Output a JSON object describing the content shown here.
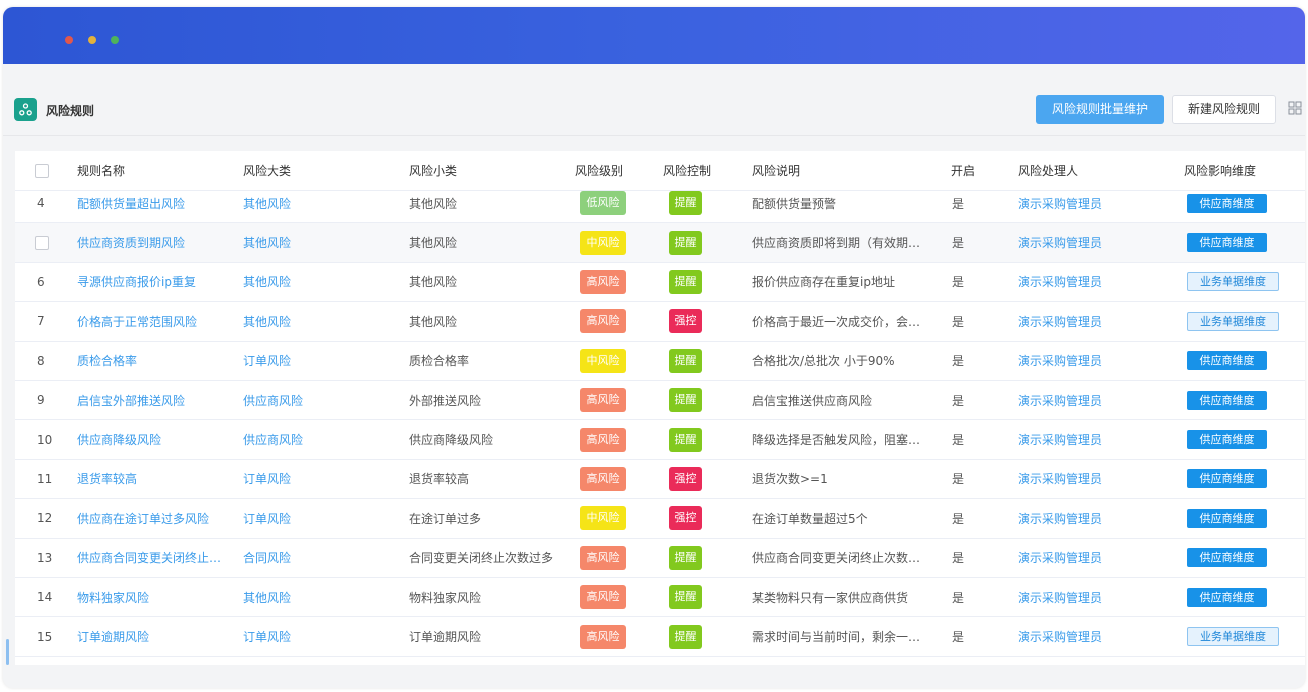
{
  "app": {
    "title": "风险规则"
  },
  "toolbar": {
    "batch_label": "风险规则批量维护",
    "new_label": "新建风险规则"
  },
  "colors": {
    "low": "#8dd07c",
    "mid": "#f5e417",
    "high": "#f5876a",
    "remind": "#82c91e",
    "strong": "#ea2b59"
  },
  "table": {
    "headers": [
      "规则名称",
      "风险大类",
      "风险小类",
      "风险级别",
      "风险控制",
      "风险说明",
      "开启",
      "风险处理人",
      "风险影响维度"
    ],
    "rows": [
      {
        "no": "4",
        "name": "配额供货量超出风险",
        "cat": "其他风险",
        "sub": "其他风险",
        "level": "低风险",
        "lv": "low",
        "ctrl": "提醒",
        "ct": "remind",
        "desc": "配额供货量预警",
        "on": "是",
        "owner": "演示采购管理员",
        "dim": "供应商维度",
        "dt": "solid"
      },
      {
        "no": "",
        "name": "供应商资质到期风险",
        "cat": "其他风险",
        "sub": "其他风险",
        "level": "中风险",
        "lv": "mid",
        "ctrl": "提醒",
        "ct": "remind",
        "desc": "供应商资质即将到期（有效期…",
        "on": "是",
        "owner": "演示采购管理员",
        "dim": "供应商维度",
        "dt": "solid"
      },
      {
        "no": "6",
        "name": "寻源供应商报价ip重复",
        "cat": "其他风险",
        "sub": "其他风险",
        "level": "高风险",
        "lv": "high",
        "ctrl": "提醒",
        "ct": "remind",
        "desc": "报价供应商存在重复ip地址",
        "on": "是",
        "owner": "演示采购管理员",
        "dim": "业务单据维度",
        "dt": "outline"
      },
      {
        "no": "7",
        "name": "价格高于正常范围风险",
        "cat": "其他风险",
        "sub": "其他风险",
        "level": "高风险",
        "lv": "high",
        "ctrl": "强控",
        "ct": "strong",
        "desc": "价格高于最近一次成交价，会…",
        "on": "是",
        "owner": "演示采购管理员",
        "dim": "业务单据维度",
        "dt": "outline"
      },
      {
        "no": "8",
        "name": "质检合格率",
        "cat": "订单风险",
        "sub": "质检合格率",
        "level": "中风险",
        "lv": "mid",
        "ctrl": "提醒",
        "ct": "remind",
        "desc": "合格批次/总批次 小于90%",
        "on": "是",
        "owner": "演示采购管理员",
        "dim": "供应商维度",
        "dt": "solid"
      },
      {
        "no": "9",
        "name": "启信宝外部推送风险",
        "cat": "供应商风险",
        "sub": "外部推送风险",
        "level": "高风险",
        "lv": "high",
        "ctrl": "提醒",
        "ct": "remind",
        "desc": "启信宝推送供应商风险",
        "on": "是",
        "owner": "演示采购管理员",
        "dim": "供应商维度",
        "dt": "solid"
      },
      {
        "no": "10",
        "name": "供应商降级风险",
        "cat": "供应商风险",
        "sub": "供应商降级风险",
        "level": "高风险",
        "lv": "high",
        "ctrl": "提醒",
        "ct": "remind",
        "desc": "降级选择是否触发风险，阻塞…",
        "on": "是",
        "owner": "演示采购管理员",
        "dim": "供应商维度",
        "dt": "solid"
      },
      {
        "no": "11",
        "name": "退货率较高",
        "cat": "订单风险",
        "sub": "退货率较高",
        "level": "高风险",
        "lv": "high",
        "ctrl": "强控",
        "ct": "strong",
        "desc": "退货次数>=1",
        "on": "是",
        "owner": "演示采购管理员",
        "dim": "供应商维度",
        "dt": "solid"
      },
      {
        "no": "12",
        "name": "供应商在途订单过多风险",
        "cat": "订单风险",
        "sub": "在途订单过多",
        "level": "中风险",
        "lv": "mid",
        "ctrl": "强控",
        "ct": "strong",
        "desc": "在途订单数量超过5个",
        "on": "是",
        "owner": "演示采购管理员",
        "dim": "供应商维度",
        "dt": "solid"
      },
      {
        "no": "13",
        "name": "供应商合同变更关闭终止…",
        "cat": "合同风险",
        "sub": "合同变更关闭终止次数过多",
        "level": "高风险",
        "lv": "high",
        "ctrl": "提醒",
        "ct": "remind",
        "desc": "供应商合同变更关闭终止次数…",
        "on": "是",
        "owner": "演示采购管理员",
        "dim": "供应商维度",
        "dt": "solid"
      },
      {
        "no": "14",
        "name": "物料独家风险",
        "cat": "其他风险",
        "sub": "物料独家风险",
        "level": "高风险",
        "lv": "high",
        "ctrl": "提醒",
        "ct": "remind",
        "desc": "某类物料只有一家供应商供货",
        "on": "是",
        "owner": "演示采购管理员",
        "dim": "供应商维度",
        "dt": "solid"
      },
      {
        "no": "15",
        "name": "订单逾期风险",
        "cat": "订单风险",
        "sub": "订单逾期风险",
        "level": "高风险",
        "lv": "high",
        "ctrl": "提醒",
        "ct": "remind",
        "desc": "需求时间与当前时间，剩余一…",
        "on": "是",
        "owner": "演示采购管理员",
        "dim": "业务单据维度",
        "dt": "outline"
      }
    ]
  }
}
